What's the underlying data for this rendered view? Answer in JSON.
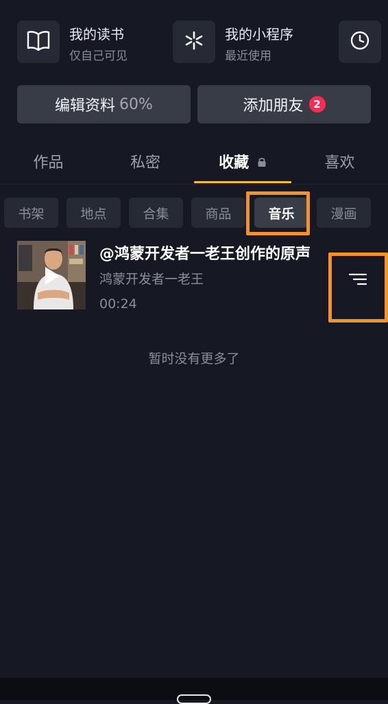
{
  "quick_entries": [
    {
      "title": "我的读书",
      "subtitle": "仅自己可见",
      "icon": "book-icon"
    },
    {
      "title": "我的小程序",
      "subtitle": "最近使用",
      "icon": "mini-program-icon"
    }
  ],
  "history_icon": "clock-icon",
  "actions": {
    "edit_profile_label": "编辑资料",
    "edit_profile_progress": "60%",
    "add_friend_label": "添加朋友",
    "add_friend_badge": "2"
  },
  "tabs": [
    {
      "label": "作品"
    },
    {
      "label": "私密"
    },
    {
      "label": "收藏",
      "lock_icon": "lock-icon"
    },
    {
      "label": "喜欢"
    }
  ],
  "active_tab": "收藏",
  "chips": [
    "书架",
    "地点",
    "合集",
    "商品",
    "音乐",
    "漫画"
  ],
  "active_chip": "音乐",
  "music_item": {
    "title": "@鸿蒙开发者一老王创作的原声",
    "artist": "鸿蒙开发者一老王",
    "duration": "00:24",
    "play_icon": "play-icon",
    "menu_icon": "list-menu-icon"
  },
  "no_more_text": "暂时没有更多了",
  "colors": {
    "background": "#161823",
    "tab_underline": "#fbc02d",
    "badge": "#fe2c55",
    "highlight": "#f5922a"
  }
}
